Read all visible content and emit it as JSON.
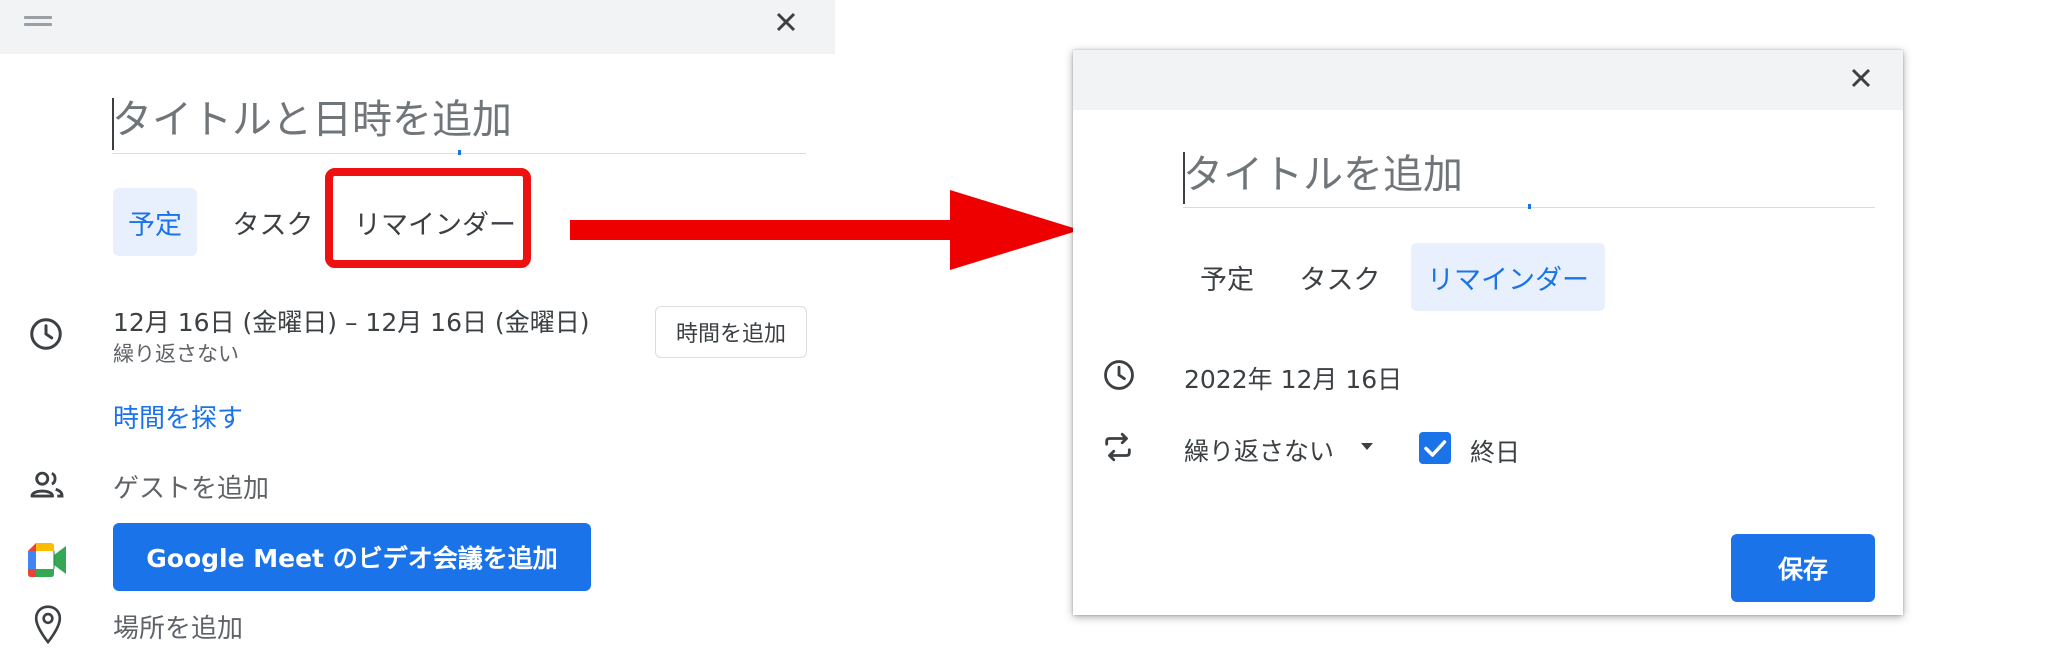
{
  "left_dialog": {
    "title_placeholder": "タイトルと日時を追加",
    "tabs": [
      "予定",
      "タスク",
      "リマインダー"
    ],
    "active_tab": "予定",
    "date_range": "12月 16日 (金曜日)  –  12月 16日 (金曜日)",
    "repeat_text": "繰り返さない",
    "add_time_button": "時間を追加",
    "find_time_link": "時間を探す",
    "add_guests": "ゲストを追加",
    "meet_button": "Google Meet のビデオ会議を追加",
    "add_location": "場所を追加"
  },
  "right_dialog": {
    "title_placeholder": "タイトルを追加",
    "tabs": [
      "予定",
      "タスク",
      "リマインダー"
    ],
    "active_tab": "リマインダー",
    "date": "2022年 12月 16日",
    "repeat_dropdown": "繰り返さない",
    "all_day_label": "終日",
    "all_day_checked": true,
    "save_button": "保存"
  },
  "colors": {
    "accent": "#1a73e8",
    "header_bg": "#f1f3f4",
    "active_tab_bg": "#e8f0fe",
    "highlight": "#ee1111"
  },
  "icons": [
    "drag-handle-icon",
    "close-icon",
    "clock-icon",
    "people-icon",
    "google-meet-icon",
    "location-pin-icon",
    "repeat-icon",
    "checkmark-icon",
    "dropdown-arrow-icon",
    "red-arrow"
  ]
}
